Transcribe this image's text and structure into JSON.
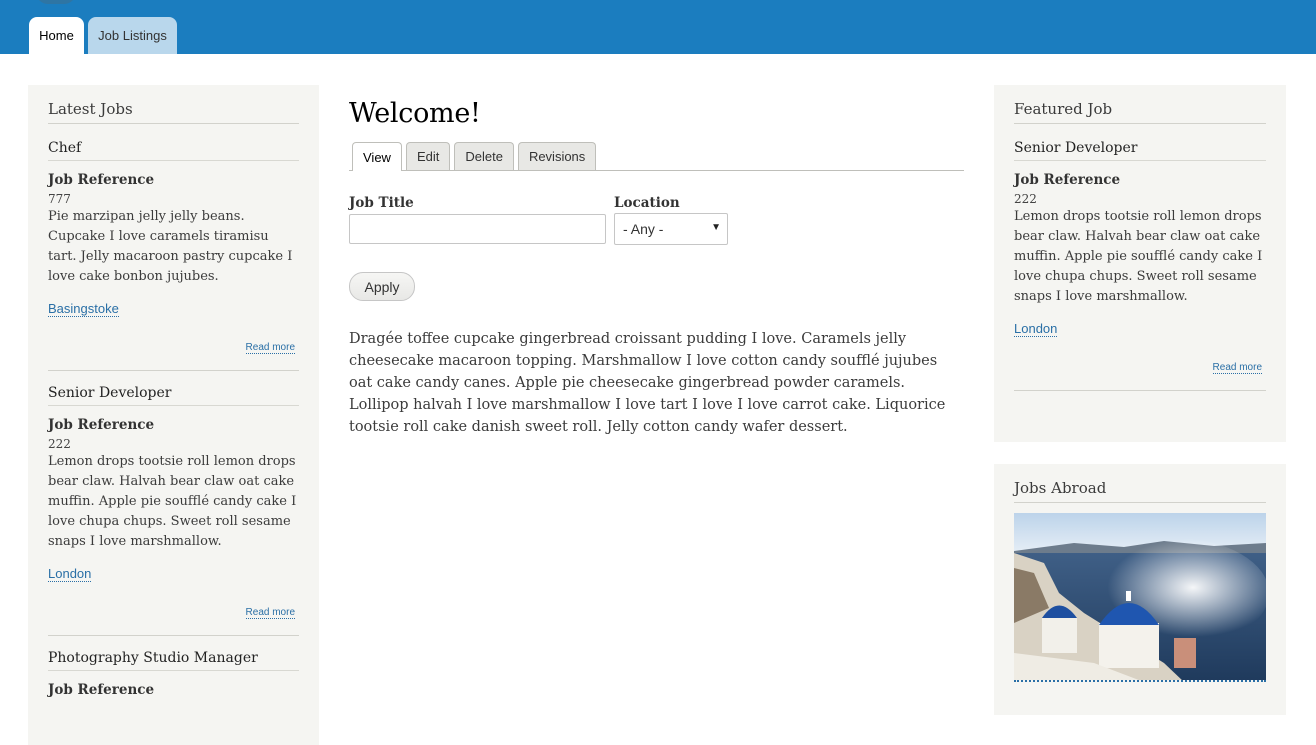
{
  "header": {
    "tabs": [
      {
        "label": "Home",
        "active": true
      },
      {
        "label": "Job Listings",
        "active": false
      }
    ],
    "colors": {
      "brand": "#1b7dbf",
      "tab_inactive": "#b9d7ec"
    }
  },
  "left_sidebar": {
    "title": "Latest Jobs",
    "jobs": [
      {
        "title": "Chef",
        "ref_label": "Job Reference",
        "ref_value": "777",
        "description": "Pie marzipan jelly jelly beans. Cupcake I love caramels tiramisu tart. Jelly macaroon pastry cupcake I love cake bonbon jujubes.",
        "location": "Basingstoke",
        "read_more": "Read more"
      },
      {
        "title": "Senior Developer",
        "ref_label": "Job Reference",
        "ref_value": "222",
        "description": "Lemon drops tootsie roll lemon drops bear claw. Halvah bear claw oat cake muffin. Apple pie soufflé candy cake I love chupa chups. Sweet roll sesame snaps I love marshmallow.",
        "location": "London",
        "read_more": "Read more"
      },
      {
        "title": "Photography Studio Manager",
        "ref_label": "Job Reference"
      }
    ]
  },
  "main": {
    "title": "Welcome!",
    "tabs": [
      {
        "label": "View",
        "active": true
      },
      {
        "label": "Edit",
        "active": false
      },
      {
        "label": "Delete",
        "active": false
      },
      {
        "label": "Revisions",
        "active": false
      }
    ],
    "filters": {
      "job_title_label": "Job Title",
      "job_title_value": "",
      "location_label": "Location",
      "location_selected": "- Any -"
    },
    "apply_label": "Apply",
    "body": "Dragée toffee cupcake gingerbread croissant pudding I love. Caramels jelly cheesecake macaroon topping. Marshmallow I love cotton candy soufflé jujubes oat cake candy canes. Apple pie cheesecake gingerbread powder caramels. Lollipop halvah I love marshmallow I love tart I love I love carrot cake. Liquorice tootsie roll cake danish sweet roll. Jelly cotton candy wafer dessert."
  },
  "featured": {
    "title": "Featured Job",
    "job": {
      "title": "Senior Developer",
      "ref_label": "Job Reference",
      "ref_value": "222",
      "description": "Lemon drops tootsie roll lemon drops bear claw. Halvah bear claw oat cake muffin. Apple pie soufflé candy cake I love chupa chups. Sweet roll sesame snaps I love marshmallow.",
      "location": "London",
      "read_more": "Read more"
    }
  },
  "abroad": {
    "title": "Jobs Abroad",
    "image_icon": "santorini-photo"
  }
}
